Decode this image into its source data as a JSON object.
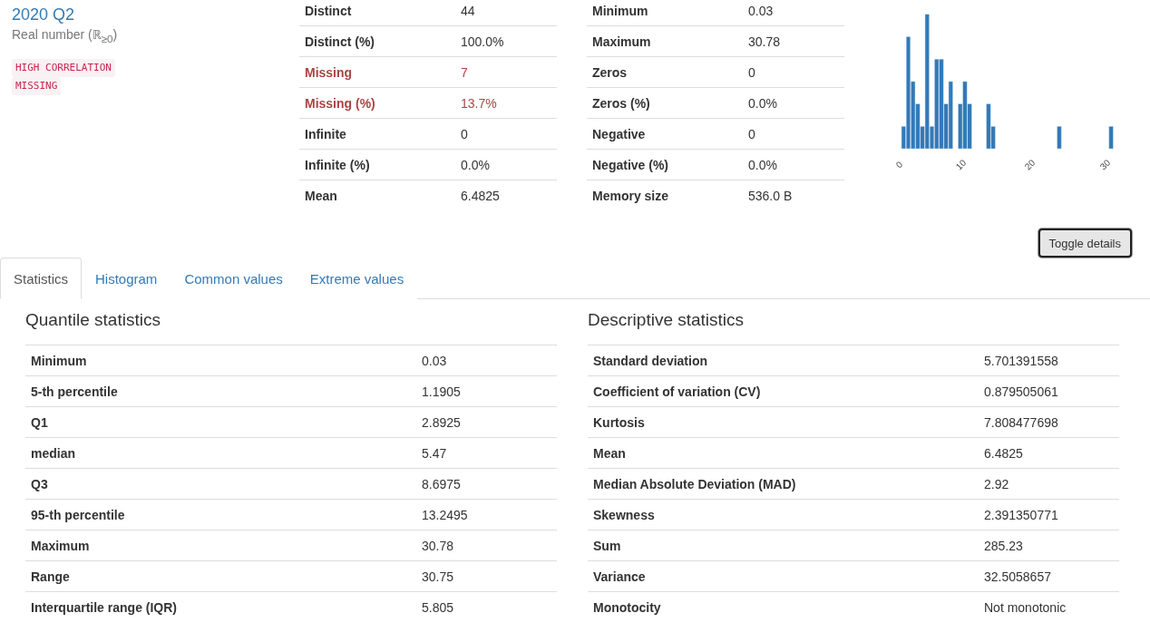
{
  "variable": {
    "name": "2020 Q2",
    "type": "Real number (ℝ$_{≥0}$)",
    "tags": [
      "HIGH CORRELATION",
      "MISSING"
    ]
  },
  "summary_tables": [
    {
      "rows": [
        {
          "label": "Distinct",
          "value": "44",
          "alert": false
        },
        {
          "label": "Distinct (%)",
          "value": "100.0%",
          "alert": false
        },
        {
          "label": "Missing",
          "value": "7",
          "alert": true
        },
        {
          "label": "Missing (%)",
          "value": "13.7%",
          "alert": true
        },
        {
          "label": "Infinite",
          "value": "0",
          "alert": false
        },
        {
          "label": "Infinite (%)",
          "value": "0.0%",
          "alert": false
        },
        {
          "label": "Mean",
          "value": "6.4825",
          "alert": false
        }
      ]
    },
    {
      "rows": [
        {
          "label": "Minimum",
          "value": "0.03",
          "alert": false
        },
        {
          "label": "Maximum",
          "value": "30.78",
          "alert": false
        },
        {
          "label": "Zeros",
          "value": "0",
          "alert": false
        },
        {
          "label": "Zeros (%)",
          "value": "0.0%",
          "alert": false
        },
        {
          "label": "Negative",
          "value": "0",
          "alert": false
        },
        {
          "label": "Negative (%)",
          "value": "0.0%",
          "alert": false
        },
        {
          "label": "Memory size",
          "value": "536.0 B",
          "alert": false
        }
      ]
    }
  ],
  "mini_histogram": {
    "kind": "picture",
    "xtick_labels": [
      "0",
      "10",
      "20",
      "30"
    ]
  },
  "toggle_button": "Toggle details",
  "tabs": [
    {
      "label": "Statistics",
      "selected": true
    },
    {
      "label": "Histogram",
      "selected": false
    },
    {
      "label": "Common values",
      "selected": false
    },
    {
      "label": "Extreme values",
      "selected": false
    }
  ],
  "panels": [
    {
      "title": "Quantile statistics",
      "rows": [
        {
          "label": "Minimum",
          "value": "0.03"
        },
        {
          "label": "5-th percentile",
          "value": "1.1905"
        },
        {
          "label": "Q1",
          "value": "2.8925"
        },
        {
          "label": "median",
          "value": "5.47"
        },
        {
          "label": "Q3",
          "value": "8.6975"
        },
        {
          "label": "95-th percentile",
          "value": "13.2495"
        },
        {
          "label": "Maximum",
          "value": "30.78"
        },
        {
          "label": "Range",
          "value": "30.75"
        },
        {
          "label": "Interquartile range (IQR)",
          "value": "5.805"
        }
      ]
    },
    {
      "title": "Descriptive statistics",
      "rows": [
        {
          "label": "Standard deviation",
          "value": "5.701391558"
        },
        {
          "label": "Coefficient of variation (CV)",
          "value": "0.879505061"
        },
        {
          "label": "Kurtosis",
          "value": "7.808477698"
        },
        {
          "label": "Mean",
          "value": "6.4825"
        },
        {
          "label": "Median Absolute Deviation (MAD)",
          "value": "2.92"
        },
        {
          "label": "Skewness",
          "value": "2.391350771"
        },
        {
          "label": "Sum",
          "value": "285.23"
        },
        {
          "label": "Variance",
          "value": "32.5058657"
        },
        {
          "label": "Monotocity",
          "value": "Not monotonic"
        }
      ]
    }
  ]
}
